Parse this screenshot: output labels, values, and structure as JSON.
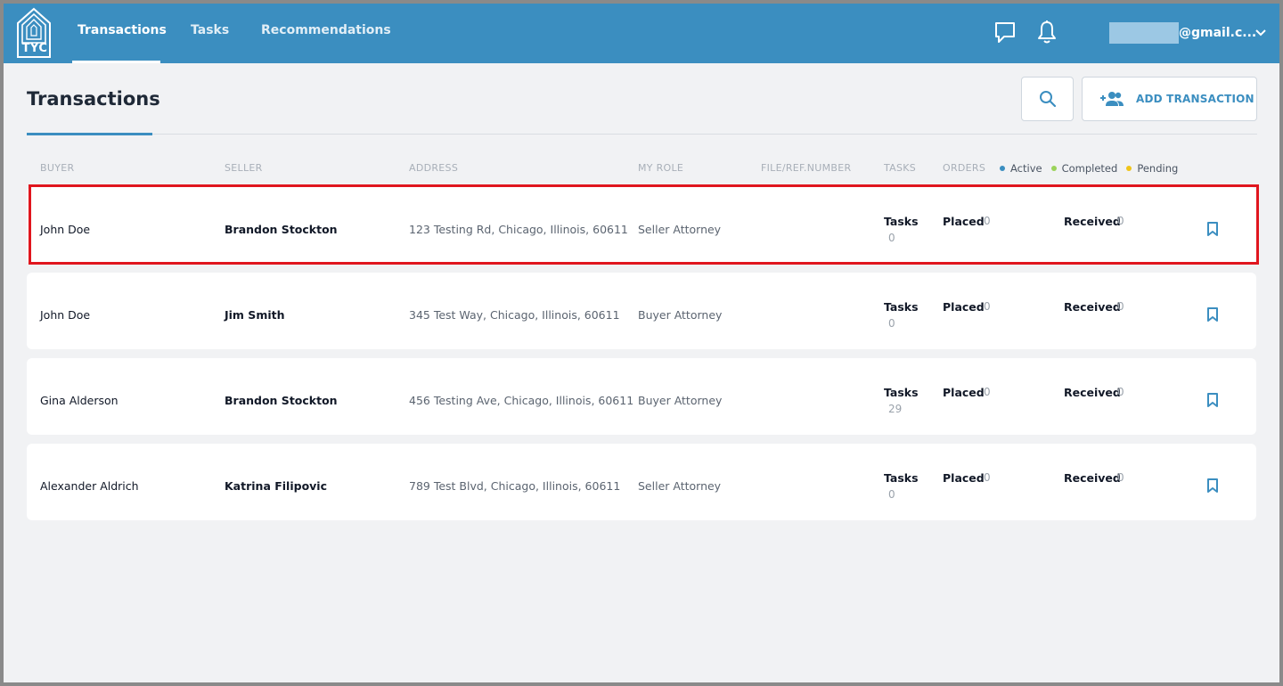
{
  "brand": {
    "logo_text": "TYC"
  },
  "nav": {
    "items": [
      {
        "label": "Transactions",
        "active": true
      },
      {
        "label": "Tasks",
        "active": false
      },
      {
        "label": "Recommendations",
        "active": false
      }
    ]
  },
  "header_icons": [
    "chat-icon",
    "bell-icon"
  ],
  "user": {
    "email_suffix": "@gmail.c..."
  },
  "page": {
    "title": "Transactions",
    "add_button_label": "ADD TRANSACTION"
  },
  "columns": {
    "buyer": "BUYER",
    "seller": "SELLER",
    "address": "ADDRESS",
    "role": "MY ROLE",
    "file_ref": "FILE/REF.NUMBER",
    "tasks": "TASKS",
    "orders": "ORDERS"
  },
  "legend": [
    {
      "label": "Active",
      "color": "#3b8ec0"
    },
    {
      "label": "Completed",
      "color": "#9bd35a"
    },
    {
      "label": "Pending",
      "color": "#f0c419"
    }
  ],
  "labels": {
    "tasks": "Tasks",
    "placed": "Placed",
    "received": "Received"
  },
  "rows": [
    {
      "buyer": "John Doe",
      "seller": "Brandon Stockton",
      "address": "123 Testing Rd, Chicago, Illinois, 60611",
      "role": "Seller Attorney",
      "tasks": "0",
      "placed": "0",
      "received": "0"
    },
    {
      "buyer": "John Doe",
      "seller": "Jim Smith",
      "address": "345 Test Way, Chicago, Illinois, 60611",
      "role": "Buyer Attorney",
      "tasks": "0",
      "placed": "0",
      "received": "0"
    },
    {
      "buyer": "Gina Alderson",
      "seller": "Brandon Stockton",
      "address": "456 Testing Ave, Chicago, Illinois, 60611",
      "role": "Buyer Attorney",
      "tasks": "29",
      "placed": "0",
      "received": "0"
    },
    {
      "buyer": "Alexander Aldrich",
      "seller": "Katrina Filipovic",
      "address": "789 Test Blvd, Chicago, Illinois, 60611",
      "role": "Seller Attorney",
      "tasks": "0",
      "placed": "0",
      "received": "0"
    }
  ],
  "colors": {
    "topbar": "#3b8ec0",
    "accent": "#3b8ec0",
    "highlight": "#e0161e"
  }
}
